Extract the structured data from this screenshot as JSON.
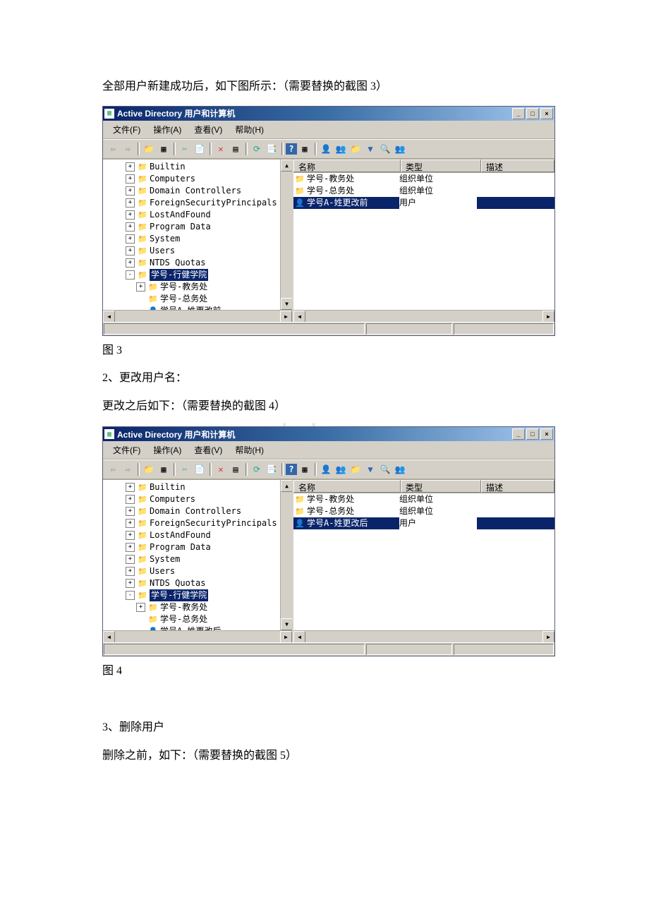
{
  "doc": {
    "p1": "全部用户新建成功后，如下图所示：（需要替换的截图 3）",
    "p2": "图 3",
    "p3": "2、更改用户名：",
    "p4": "更改之后如下：（需要替换的截图 4）",
    "watermark": "www.bdocx.com",
    "p5": "图 4",
    "p6": "3、删除用户",
    "p7": "删除之前，如下：（需要替换的截图 5）"
  },
  "win": {
    "title": "Active Directory 用户和计算机",
    "menu": {
      "file": "文件(F)",
      "action": "操作(A)",
      "view": "查看(V)",
      "help": "帮助(H)"
    },
    "cols": {
      "name": "名称",
      "type": "类型",
      "desc": "描述"
    }
  },
  "tree3": {
    "items": [
      {
        "exp": "+",
        "lvl": 0,
        "icon": "folder",
        "label": "Builtin"
      },
      {
        "exp": "+",
        "lvl": 0,
        "icon": "folder",
        "label": "Computers"
      },
      {
        "exp": "+",
        "lvl": 0,
        "icon": "ou",
        "label": "Domain Controllers"
      },
      {
        "exp": "+",
        "lvl": 0,
        "icon": "folder",
        "label": "ForeignSecurityPrincipals"
      },
      {
        "exp": "+",
        "lvl": 0,
        "icon": "folder",
        "label": "LostAndFound"
      },
      {
        "exp": "+",
        "lvl": 0,
        "icon": "folder",
        "label": "Program Data"
      },
      {
        "exp": "+",
        "lvl": 0,
        "icon": "folder",
        "label": "System"
      },
      {
        "exp": "+",
        "lvl": 0,
        "icon": "folder",
        "label": "Users"
      },
      {
        "exp": "+",
        "lvl": 0,
        "icon": "folder",
        "label": "NTDS Quotas"
      },
      {
        "exp": "-",
        "lvl": 0,
        "icon": "ou",
        "label": "学号-行健学院",
        "sel": true
      },
      {
        "exp": "+",
        "lvl": 1,
        "icon": "ou",
        "label": "学号-教务处"
      },
      {
        "exp": "",
        "lvl": 1,
        "icon": "ou",
        "label": "学号-总务处"
      },
      {
        "exp": "",
        "lvl": 1,
        "icon": "user",
        "label": "学号A-姓更改前"
      }
    ]
  },
  "list3": {
    "rows": [
      {
        "icon": "ou",
        "name": "学号-教务处",
        "type": "组织单位",
        "desc": ""
      },
      {
        "icon": "ou",
        "name": "学号-总务处",
        "type": "组织单位",
        "desc": ""
      },
      {
        "icon": "user",
        "name": "学号A-姓更改前",
        "type": "用户",
        "desc": "",
        "sel": true
      }
    ]
  },
  "tree4": {
    "items": [
      {
        "exp": "+",
        "lvl": 0,
        "icon": "folder",
        "label": "Builtin"
      },
      {
        "exp": "+",
        "lvl": 0,
        "icon": "folder",
        "label": "Computers"
      },
      {
        "exp": "+",
        "lvl": 0,
        "icon": "ou",
        "label": "Domain Controllers"
      },
      {
        "exp": "+",
        "lvl": 0,
        "icon": "folder",
        "label": "ForeignSecurityPrincipals"
      },
      {
        "exp": "+",
        "lvl": 0,
        "icon": "folder",
        "label": "LostAndFound"
      },
      {
        "exp": "+",
        "lvl": 0,
        "icon": "folder",
        "label": "Program Data"
      },
      {
        "exp": "+",
        "lvl": 0,
        "icon": "folder",
        "label": "System"
      },
      {
        "exp": "+",
        "lvl": 0,
        "icon": "folder",
        "label": "Users"
      },
      {
        "exp": "+",
        "lvl": 0,
        "icon": "folder",
        "label": "NTDS Quotas"
      },
      {
        "exp": "-",
        "lvl": 0,
        "icon": "ou",
        "label": "学号-行健学院",
        "sel": true
      },
      {
        "exp": "+",
        "lvl": 1,
        "icon": "ou",
        "label": "学号-教务处"
      },
      {
        "exp": "",
        "lvl": 1,
        "icon": "ou",
        "label": "学号-总务处"
      },
      {
        "exp": "",
        "lvl": 1,
        "icon": "user",
        "label": "学号A-姓更改后"
      }
    ]
  },
  "list4": {
    "rows": [
      {
        "icon": "ou",
        "name": "学号-教务处",
        "type": "组织单位",
        "desc": ""
      },
      {
        "icon": "ou",
        "name": "学号-总务处",
        "type": "组织单位",
        "desc": ""
      },
      {
        "icon": "user",
        "name": "学号A-姓更改后",
        "type": "用户",
        "desc": "",
        "sel": true
      }
    ]
  }
}
